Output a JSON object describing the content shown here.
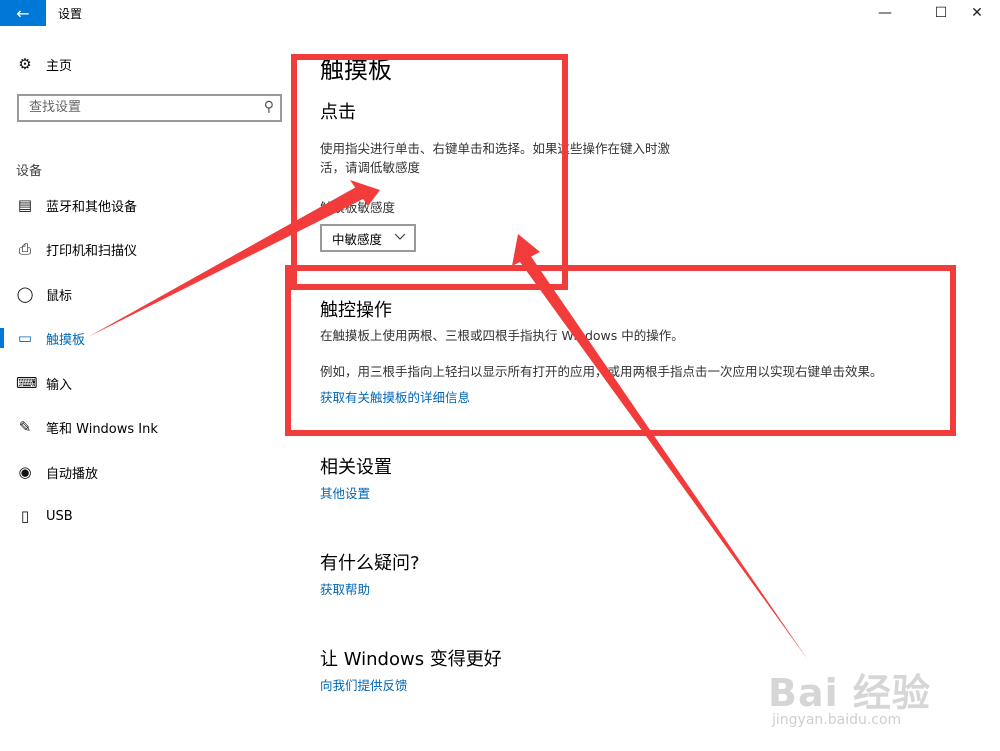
{
  "window": {
    "title": "设置",
    "back_icon": "←",
    "minimize_icon": "—",
    "maximize_icon": "☐",
    "close_icon": "✕"
  },
  "sidebar": {
    "home": {
      "icon": "⚙",
      "label": "主页"
    },
    "search": {
      "placeholder": "查找设置",
      "icon": "⚲"
    },
    "section": "设备",
    "items": [
      {
        "icon": "▤",
        "label": "蓝牙和其他设备"
      },
      {
        "icon": "⎙",
        "label": "打印机和扫描仪"
      },
      {
        "icon": "◯",
        "label": "鼠标"
      },
      {
        "icon": "▭",
        "label": "触摸板",
        "active": true
      },
      {
        "icon": "⌨",
        "label": "输入"
      },
      {
        "icon": "✎",
        "label": "笔和 Windows Ink"
      },
      {
        "icon": "◉",
        "label": "自动播放"
      },
      {
        "icon": "▯",
        "label": "USB"
      }
    ]
  },
  "main": {
    "title": "触摸板",
    "tap": {
      "heading": "点击",
      "description_line1": "使用指尖进行单击、右键单击和选择。如果这些操作在键入时激",
      "description_line2": "活，请调低敏感度",
      "sensitivity_label": "触摸板敏感度",
      "sensitivity_value": "中敏感度"
    },
    "gestures": {
      "heading": "触控操作",
      "description": "在触摸板上使用两根、三根或四根手指执行 Windows 中的操作。",
      "example": "例如，用三根手指向上轻扫以显示所有打开的应用，或用两根手指点击一次应用以实现右键单击效果。",
      "link": "获取有关触摸板的详细信息"
    },
    "related": {
      "heading": "相关设置",
      "link": "其他设置"
    },
    "question": {
      "heading": "有什么疑问?",
      "link": "获取帮助"
    },
    "feedback": {
      "heading": "让 Windows 变得更好",
      "link": "向我们提供反馈"
    }
  },
  "watermark": {
    "text": "Bai 经验",
    "url": "jingyan.baidu.com"
  },
  "colors": {
    "accent": "#0078d7",
    "link": "#0067b8",
    "annotation_red": "#f23b3b"
  }
}
